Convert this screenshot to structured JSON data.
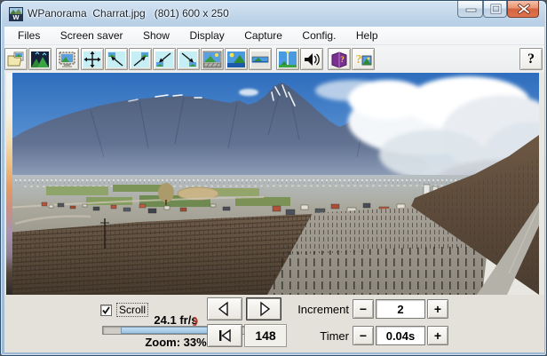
{
  "window": {
    "title": "WPanorama  Charrat.jpg   (801) 600 x 250"
  },
  "menu": {
    "items": [
      "Files",
      "Screen saver",
      "Show",
      "Display",
      "Capture",
      "Config.",
      "Help"
    ]
  },
  "toolbar": {
    "help_label": "?",
    "buttons": [
      "open-image",
      "screensaver",
      "fullscreen-monitor",
      "pan-all-directions",
      "scroll-up-left",
      "scroll-up-right",
      "scroll-down-left",
      "scroll-down-right",
      "window-view",
      "full-image-view",
      "strip-view",
      "vertical-panorama",
      "sound",
      "help-book",
      "about"
    ]
  },
  "controls": {
    "scroll_label": "Scroll",
    "scroll_checked": true,
    "fps": "24.1 fr/s",
    "zoom": "Zoom: 33%",
    "frame": "148",
    "increment_label": "Increment",
    "increment_value": "2",
    "timer_label": "Timer",
    "timer_value": "0.04s",
    "minus_glyph": "−",
    "plus_glyph": "+",
    "position": {
      "fill_start_pct": 12,
      "fill_width_pct": 82,
      "thumb_pct": 97
    }
  },
  "colors": {
    "titlebar_blue": "#a8c3dc",
    "close_red": "#d4633f",
    "panel_bg": "#e4e1da",
    "progress_fill": "#9cc4e4",
    "menu_bg": "#f6f7f8"
  }
}
